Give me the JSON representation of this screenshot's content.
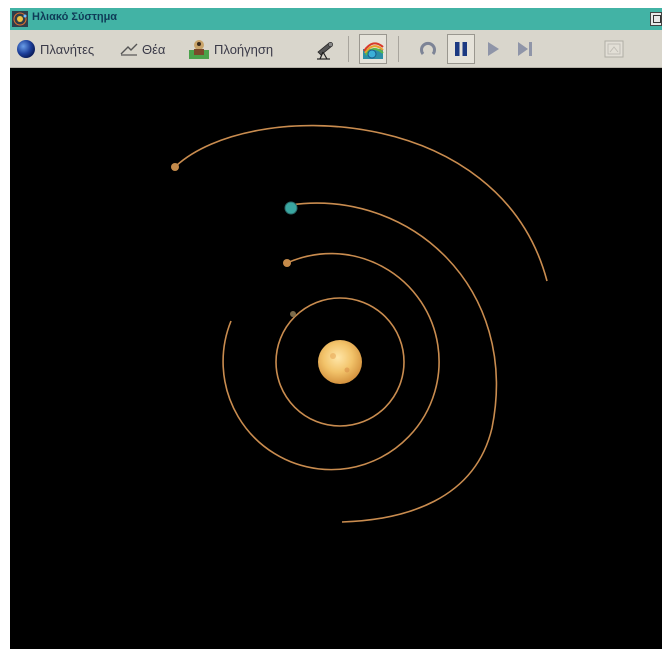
{
  "window": {
    "title": "Ηλιακό Σύστημα"
  },
  "toolbar": {
    "planets_label": "Πλανήτες",
    "view_label": "Θέα",
    "navigation_label": "Πλοήγηση"
  },
  "icons": {
    "app": "solar-system-app-icon",
    "planets": "blue-globe-icon",
    "view": "eye-scale-icon",
    "navigation": "navigator-icon",
    "telescope": "telescope-icon",
    "orbits": "orbit-rainbow-icon",
    "reset": "rotate-icon",
    "pause": "pause-icon",
    "play": "play-icon",
    "step": "step-forward-icon",
    "disabled": "disabled-tool-icon"
  },
  "colors": {
    "titlebar": "#42b3a5",
    "toolbar": "#d9d6cc",
    "space": "#000000",
    "orbit": "#c98c4f",
    "sun": "#f2c36a"
  }
}
